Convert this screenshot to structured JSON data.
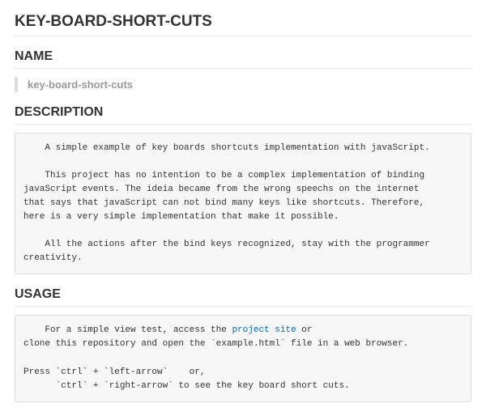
{
  "title": "KEY-BOARD-SHORT-CUTS",
  "sections": {
    "name": {
      "heading": "NAME",
      "value": "key-board-short-cuts"
    },
    "description": {
      "heading": "DESCRIPTION",
      "body": "    A simple example of key boards shortcuts implementation with javaScript.\n\n    This project has no intention to be a complex implementation of binding\njavaScript events. The ideia became from the wrong speechs on the internet\nthat says that javaScript can not bind many keys like shortcuts. Therefore,\nhere is a very simple implementation that make it possible.\n\n    All the actions after the bind keys recognized, stay with the programmer\ncreativity."
    },
    "usage": {
      "heading": "USAGE",
      "pre_link": "    For a simple view test, access the ",
      "link_text": "project site",
      "post_link": " or\nclone this repository and open the `example.html` file in a web browser.\n\nPress `ctrl` + `left-arrow`    or,\n      `ctrl` + `right-arrow` to see the key board short cuts."
    }
  }
}
